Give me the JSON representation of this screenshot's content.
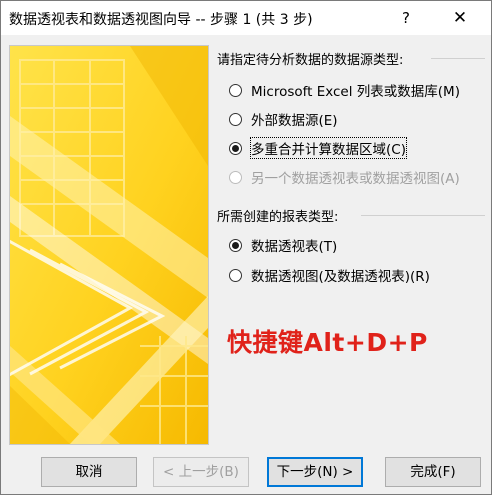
{
  "window": {
    "title": "数据透视表和数据透视图向导 -- 步骤 1 (共 3 步)",
    "help_glyph": "?",
    "close_glyph": "✕"
  },
  "source_section": {
    "label": "请指定待分析数据的数据源类型:",
    "options": [
      {
        "label": "Microsoft Excel 列表或数据库(M)",
        "selected": false,
        "enabled": true
      },
      {
        "label": "外部数据源(E)",
        "selected": false,
        "enabled": true
      },
      {
        "label": "多重合并计算数据区域(C)",
        "selected": true,
        "enabled": true
      },
      {
        "label": "另一个数据透视表或数据透视图(A)",
        "selected": false,
        "enabled": false
      }
    ]
  },
  "report_section": {
    "label": "所需创建的报表类型:",
    "options": [
      {
        "label": "数据透视表(T)",
        "selected": true,
        "enabled": true
      },
      {
        "label": "数据透视图(及数据透视表)(R)",
        "selected": false,
        "enabled": true
      }
    ]
  },
  "annotation": {
    "text": "快捷键Alt+D+P",
    "color": "#e0221a"
  },
  "buttons": {
    "cancel": "取消",
    "back": "< 上一步(B)",
    "next": "下一步(N) >",
    "finish": "完成(F)"
  },
  "colors": {
    "accent": "#0078d7",
    "art_yellow": "#ffd21f"
  }
}
